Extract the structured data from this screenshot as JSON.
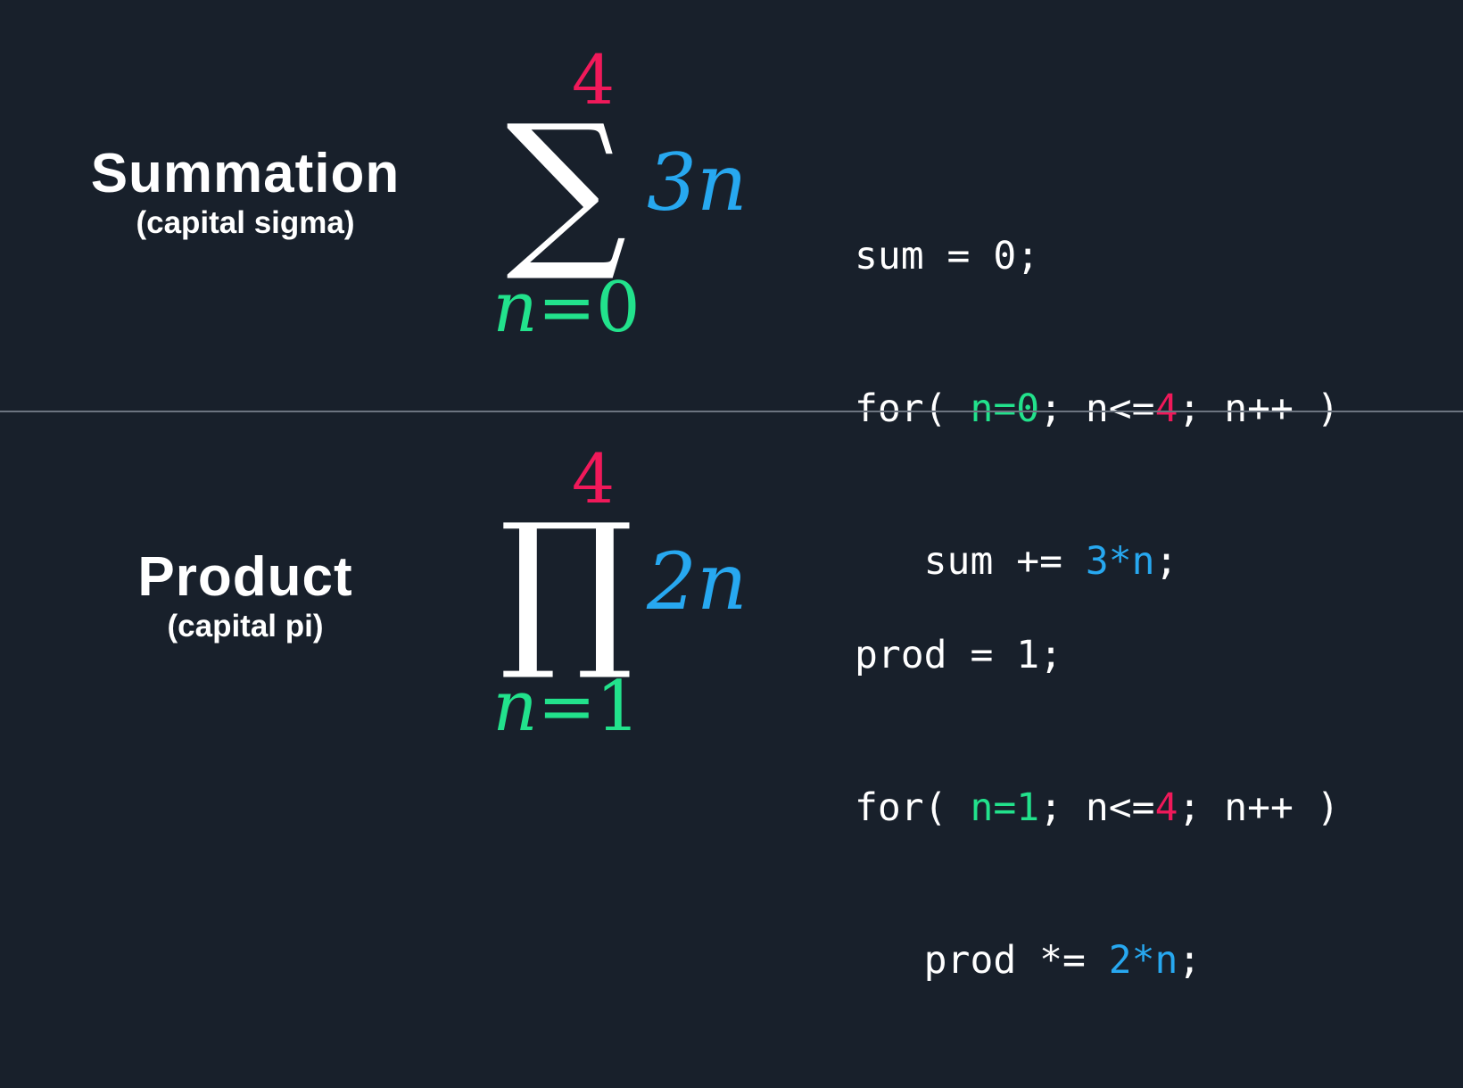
{
  "colors": {
    "background": "#18202b",
    "divider": "#6c7480",
    "upper_bound": "#f0195a",
    "lower_bound": "#22e28c",
    "term": "#27a8f0",
    "text": "#ffffff"
  },
  "summation": {
    "title": "Summation",
    "subtitle": "(capital sigma)",
    "upper": "4",
    "operator": "∑",
    "term": "3n",
    "lower_var": "n",
    "lower_eq": "=0",
    "code": {
      "line1": "sum = 0;",
      "l2_for": "for( ",
      "l2_init": "n=0",
      "l2_mid": "; n<=",
      "l2_bound": "4",
      "l2_end": "; n++ )",
      "l3_indent": "   sum += ",
      "l3_expr": "3*n",
      "l3_end": ";"
    }
  },
  "product": {
    "title": "Product",
    "subtitle": "(capital pi)",
    "upper": "4",
    "operator": "∏",
    "term": "2n",
    "lower_var": "n",
    "lower_eq": "=1",
    "code": {
      "line1": "prod = 1;",
      "l2_for": "for( ",
      "l2_init": "n=1",
      "l2_mid": "; n<=",
      "l2_bound": "4",
      "l2_end": "; n++ )",
      "l3_indent": "   prod *= ",
      "l3_expr": "2*n",
      "l3_end": ";"
    }
  }
}
